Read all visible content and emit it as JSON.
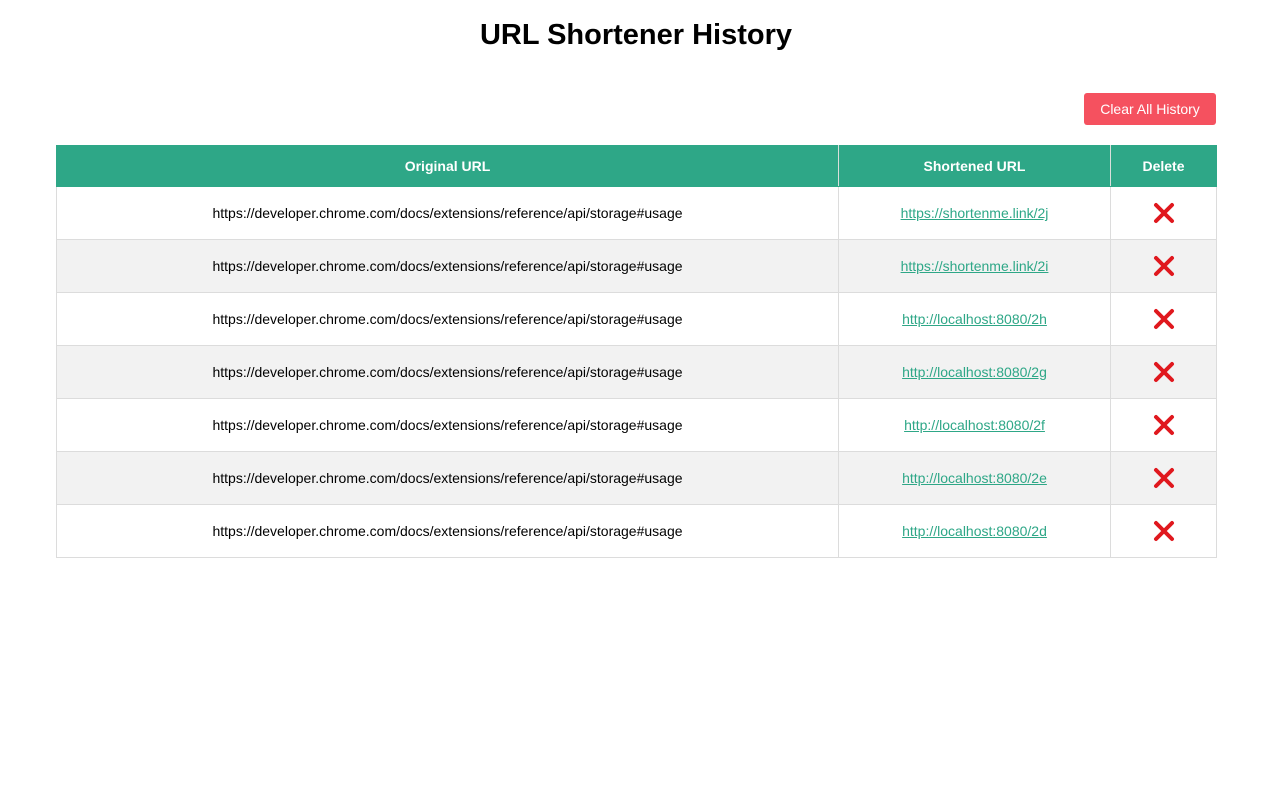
{
  "page": {
    "title": "URL Shortener History"
  },
  "toolbar": {
    "clear_label": "Clear All History"
  },
  "colors": {
    "header_bg": "#2ea787",
    "link": "#2ea787",
    "clear_button": "#f5515f",
    "delete_icon": "#e0181e",
    "row_alt_bg": "#f2f2f2"
  },
  "table": {
    "headers": [
      "Original URL",
      "Shortened URL",
      "Delete"
    ],
    "rows": [
      {
        "original": "https://developer.chrome.com/docs/extensions/reference/api/storage#usage",
        "short": "https://shortenme.link/2j",
        "delete_icon": "close-icon"
      },
      {
        "original": "https://developer.chrome.com/docs/extensions/reference/api/storage#usage",
        "short": "https://shortenme.link/2i",
        "delete_icon": "close-icon"
      },
      {
        "original": "https://developer.chrome.com/docs/extensions/reference/api/storage#usage",
        "short": "http://localhost:8080/2h",
        "delete_icon": "close-icon"
      },
      {
        "original": "https://developer.chrome.com/docs/extensions/reference/api/storage#usage",
        "short": "http://localhost:8080/2g",
        "delete_icon": "close-icon"
      },
      {
        "original": "https://developer.chrome.com/docs/extensions/reference/api/storage#usage",
        "short": "http://localhost:8080/2f",
        "delete_icon": "close-icon"
      },
      {
        "original": "https://developer.chrome.com/docs/extensions/reference/api/storage#usage",
        "short": "http://localhost:8080/2e",
        "delete_icon": "close-icon"
      },
      {
        "original": "https://developer.chrome.com/docs/extensions/reference/api/storage#usage",
        "short": "http://localhost:8080/2d",
        "delete_icon": "close-icon"
      }
    ]
  }
}
